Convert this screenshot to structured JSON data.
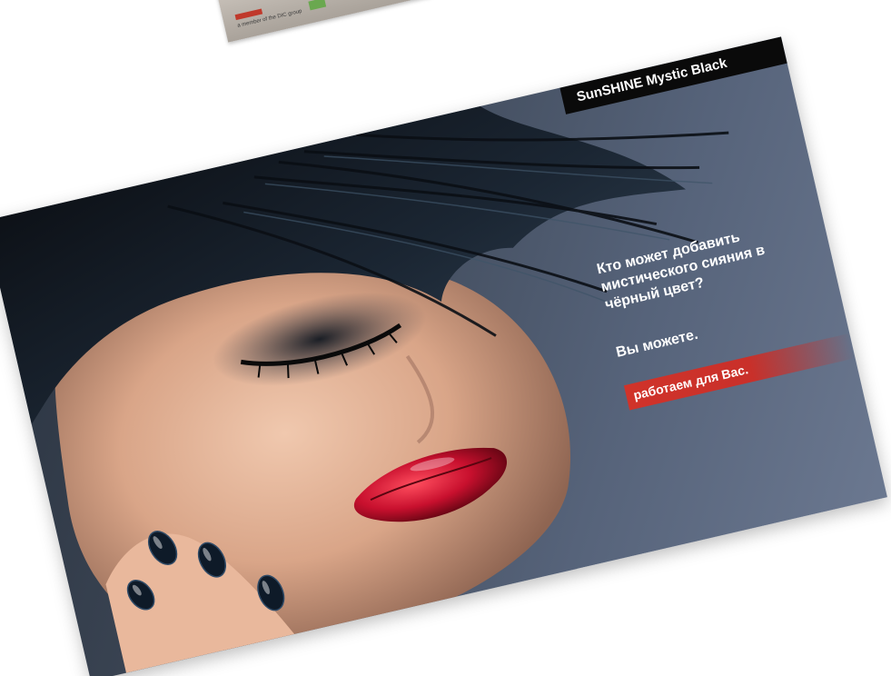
{
  "top_page": {
    "member_text": "a member of the DIC group",
    "brand_red": "#c0392b",
    "brand_green": "#6aa84f"
  },
  "ad": {
    "product_label": "SunSHINE Mystic Black",
    "headline_lines": [
      "Кто может добавить",
      "мистического сияния в",
      "чёрный цвет?"
    ],
    "you_can": "Вы можете.",
    "slogan": "работаем для Вас.",
    "accent_color": "#d0332a",
    "label_bg": "#0a0a0a"
  }
}
